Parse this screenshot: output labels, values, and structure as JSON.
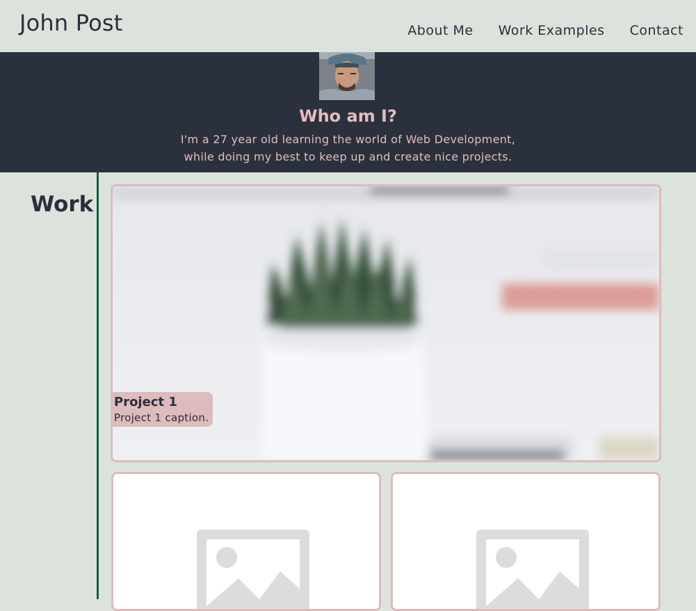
{
  "header": {
    "site_title": "John Post",
    "nav": [
      "About Me",
      "Work Examples",
      "Contact"
    ]
  },
  "hero": {
    "avatar_icon": "profile-photo",
    "title": "Who am I?",
    "text_line1": "I'm a 27 year old learning the world of Web Development,",
    "text_line2": "while doing my best to keep up and create nice projects."
  },
  "work": {
    "heading": "Work",
    "projects": [
      {
        "title": "Project 1",
        "caption": "Project 1 caption.",
        "image": "plant-in-white-pot-photo"
      },
      {
        "image": "image-placeholder-icon"
      },
      {
        "image": "image-placeholder-icon"
      }
    ]
  },
  "colors": {
    "background": "#dce3dc",
    "hero_background": "#2b303d",
    "accent_pink": "#dcbcbc",
    "divider_green": "#136047",
    "text_dark": "#2a2f3c"
  }
}
